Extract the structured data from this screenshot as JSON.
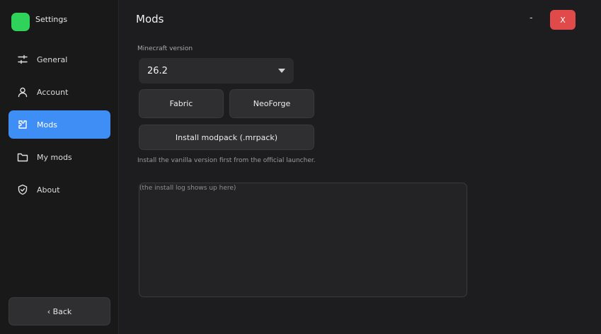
{
  "sidebar": {
    "brand": {
      "title": "Settings",
      "logo_color": "#2fd35a"
    },
    "items": [
      {
        "label": "General",
        "icon": "sliders-icon",
        "active": false
      },
      {
        "label": "Account",
        "icon": "user-icon",
        "active": false
      },
      {
        "label": "Mods",
        "icon": "puzzle-icon",
        "active": true
      },
      {
        "label": "My mods",
        "icon": "folder-icon",
        "active": false
      },
      {
        "label": "About",
        "icon": "shield-check-icon",
        "active": false
      }
    ],
    "back_label": "‹ Back"
  },
  "header": {
    "title": "Mods",
    "minimize_label": "-",
    "close_label": "X"
  },
  "main": {
    "version_label": "Minecraft version",
    "version_value": "26.2",
    "fabric_label": "Fabric",
    "neoforge_label": "NeoForge",
    "modpack_label": "Install modpack (.mrpack)",
    "hint": "Install the vanilla version first from the official launcher.",
    "log_placeholder": "(the install log shows up here)"
  },
  "colors": {
    "accent": "#3f8ef5",
    "close": "#e04a4a",
    "background": "#1d1d1f",
    "sidebar": "#19191a"
  }
}
